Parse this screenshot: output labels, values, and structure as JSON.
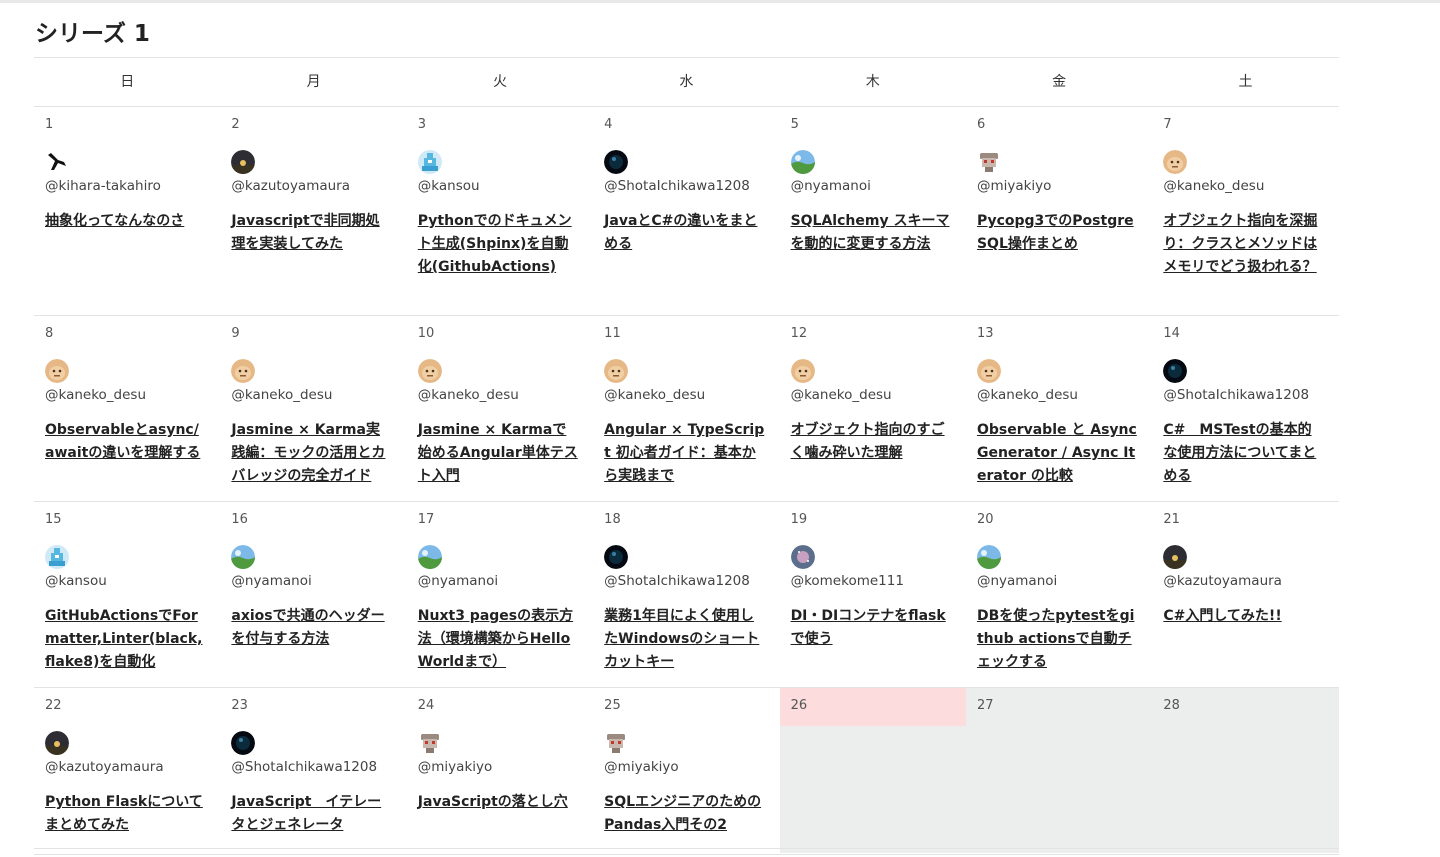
{
  "series_title": "シリーズ 1",
  "weekdays": [
    "日",
    "月",
    "火",
    "水",
    "木",
    "金",
    "土"
  ],
  "weeks": [
    [
      {
        "day": "1",
        "author": "@kihara-takahiro",
        "avatar": "bird-silhouette-icon",
        "title": "抽象化ってなんなのさ"
      },
      {
        "day": "2",
        "author": "@kazutoyamaura",
        "avatar": "night-sky-avatar",
        "title": "Javascriptで非同期処理を実装してみた"
      },
      {
        "day": "3",
        "author": "@kansou",
        "avatar": "pixel-avatar",
        "title": "Pythonでのドキュメント生成(Shpinx)を自動化(GithubActions)"
      },
      {
        "day": "4",
        "author": "@ShotaIchikawa1208",
        "avatar": "dark-orb-avatar",
        "title": "JavaとC#の違いをまとめる"
      },
      {
        "day": "5",
        "author": "@nyamanoi",
        "avatar": "landscape-avatar",
        "title": "SQLAlchemy スキーマを動的に変更する方法"
      },
      {
        "day": "6",
        "author": "@miyakiyo",
        "avatar": "robot-avatar",
        "title": "Pycopg3でのPostgreSQL操作まとめ"
      },
      {
        "day": "7",
        "author": "@kaneko_desu",
        "avatar": "face-avatar",
        "title": "オブジェクト指向を深掘り：クラスとメソッドはメモリでどう扱われる？"
      }
    ],
    [
      {
        "day": "8",
        "author": "@kaneko_desu",
        "avatar": "face-avatar",
        "title": "Observableとasync/awaitの違いを理解する"
      },
      {
        "day": "9",
        "author": "@kaneko_desu",
        "avatar": "face-avatar",
        "title": "Jasmine × Karma実践編：モックの活用とカバレッジの完全ガイド"
      },
      {
        "day": "10",
        "author": "@kaneko_desu",
        "avatar": "face-avatar",
        "title": "Jasmine × Karmaで始めるAngular単体テスト入門"
      },
      {
        "day": "11",
        "author": "@kaneko_desu",
        "avatar": "face-avatar",
        "title": "Angular × TypeScript 初心者ガイド：基本から実践まで"
      },
      {
        "day": "12",
        "author": "@kaneko_desu",
        "avatar": "face-avatar",
        "title": "オブジェクト指向のすごく噛み砕いた理解"
      },
      {
        "day": "13",
        "author": "@kaneko_desu",
        "avatar": "face-avatar",
        "title": "Observable と Async Generator / Async Iterator の比較"
      },
      {
        "day": "14",
        "author": "@ShotaIchikawa1208",
        "avatar": "dark-orb-avatar",
        "title": "C#　MSTestの基本的な使用方法についてまとめる"
      }
    ],
    [
      {
        "day": "15",
        "author": "@kansou",
        "avatar": "pixel-avatar",
        "title": "GitHubActionsでFormatter,Linter(black,flake8)を自動化"
      },
      {
        "day": "16",
        "author": "@nyamanoi",
        "avatar": "landscape-avatar",
        "title": "axiosで共通のヘッダーを付与する方法"
      },
      {
        "day": "17",
        "author": "@nyamanoi",
        "avatar": "landscape-avatar",
        "title": "Nuxt3 pagesの表示方法（環境構築からHello Worldまで）"
      },
      {
        "day": "18",
        "author": "@ShotaIchikawa1208",
        "avatar": "dark-orb-avatar",
        "title": "業務1年目によく使用したWindowsのショートカットキー"
      },
      {
        "day": "19",
        "author": "@komekome111",
        "avatar": "galaxy-avatar",
        "title": "DI・DIコンテナをflaskで使う"
      },
      {
        "day": "20",
        "author": "@nyamanoi",
        "avatar": "landscape-avatar",
        "title": "DBを使ったpytestをgithub actionsで自動チェックする"
      },
      {
        "day": "21",
        "author": "@kazutoyamaura",
        "avatar": "night-sky-avatar",
        "title": "C#入門してみた!!"
      }
    ],
    [
      {
        "day": "22",
        "author": "@kazutoyamaura",
        "avatar": "night-sky-avatar",
        "title": "Python Flaskについてまとめてみた"
      },
      {
        "day": "23",
        "author": "@ShotaIchikawa1208",
        "avatar": "dark-orb-avatar",
        "title": "JavaScript　イテレータとジェネレータ"
      },
      {
        "day": "24",
        "author": "@miyakiyo",
        "avatar": "robot-avatar",
        "title": "JavaScriptの落とし穴"
      },
      {
        "day": "25",
        "author": "@miyakiyo",
        "avatar": "robot-avatar",
        "title": "SQLエンジニアのためのPandas入門その2"
      },
      {
        "day": "26",
        "empty": true,
        "today": true
      },
      {
        "day": "27",
        "empty": true
      },
      {
        "day": "28",
        "empty": true
      }
    ]
  ],
  "colors": {
    "empty_cell": "#eceeee",
    "today_highlight": "#fcdcdc",
    "border": "#e3e3e3"
  }
}
